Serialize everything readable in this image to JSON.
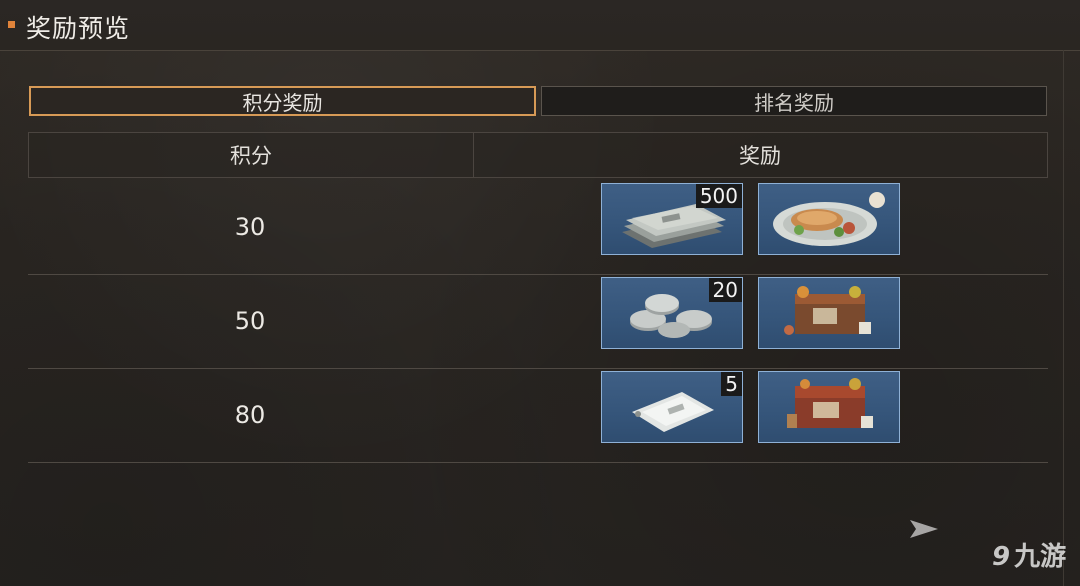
{
  "header": {
    "title": "奖励预览"
  },
  "tabs": [
    {
      "label": "积分奖励",
      "active": true
    },
    {
      "label": "排名奖励",
      "active": false
    }
  ],
  "table": {
    "columns": [
      "积分",
      "奖励"
    ],
    "rows": [
      {
        "points": "30",
        "rewards": [
          {
            "icon": "cash-stack-icon",
            "count": "500"
          },
          {
            "icon": "food-plate-icon",
            "count": ""
          }
        ]
      },
      {
        "points": "50",
        "rewards": [
          {
            "icon": "silver-coins-icon",
            "count": "20"
          },
          {
            "icon": "supply-crate-icon",
            "count": ""
          }
        ]
      },
      {
        "points": "80",
        "rewards": [
          {
            "icon": "sealed-packet-icon",
            "count": "5"
          },
          {
            "icon": "supply-crate-icon",
            "count": ""
          }
        ]
      }
    ]
  },
  "watermark": {
    "text": "九游"
  },
  "colors": {
    "accent": "#e0833a",
    "tab_active_border": "#d79a56",
    "item_bg": "#3a5a80",
    "item_border": "#8fb1d6"
  }
}
